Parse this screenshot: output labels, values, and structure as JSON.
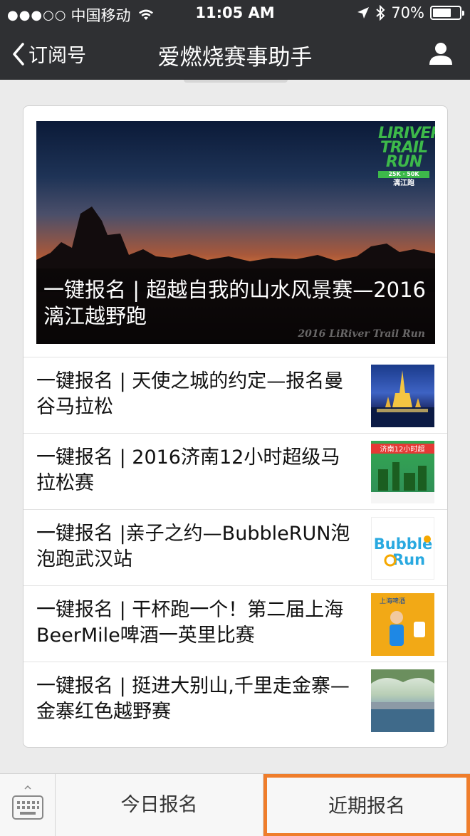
{
  "status_bar": {
    "carrier": "中国移动",
    "time": "11:05 AM",
    "battery": "70%",
    "battery_level": 0.7
  },
  "nav": {
    "back_label": "订阅号",
    "title": "爱燃烧赛事助手",
    "user_icon": "user-icon"
  },
  "featured": {
    "title": "一键报名 | 超越自我的山水风景赛—2016漓江越野跑",
    "logo_lines": [
      "LIRIVER",
      "TRAIL",
      "RUN"
    ],
    "logo_sub": "25K · 50K",
    "logo_cn": "漓江跑",
    "watermark": "2016 LiRiver Trail Run"
  },
  "articles": [
    {
      "title": "一键报名 | 天使之城的约定—报名曼谷马拉松"
    },
    {
      "title": "一键报名 | 2016济南12小时超级马拉松赛"
    },
    {
      "title": "一键报名 |亲子之约—BubbleRUN泡泡跑武汉站"
    },
    {
      "title": "一键报名 | 干杯跑一个！第二届上海BeerMile啤酒一英里比赛"
    },
    {
      "title": "一键报名 | 挺进大别山,千里走金寨—金寨红色越野赛"
    }
  ],
  "thumbs": {
    "t2_text": "济南12小时超",
    "t3_line1": "Bubble",
    "t3_line2": "Run",
    "t4_text": "上海啤酒"
  },
  "bottom": {
    "keyboard_icon": "keyboard-icon",
    "tab_today": "今日报名",
    "tab_recent": "近期报名"
  },
  "colors": {
    "bar_bg": "#2f3033",
    "highlight": "#ef7d2b",
    "logo_green": "#3db94a"
  }
}
